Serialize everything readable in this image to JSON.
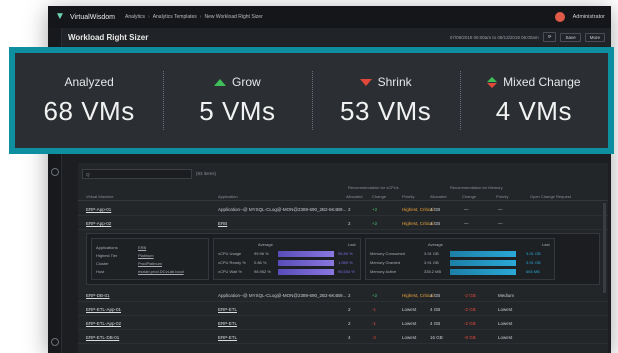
{
  "app": {
    "brand": "VirtualWisdom",
    "breadcrumbs": [
      "Analytics",
      "Analytics Templates",
      "New Workload Right Sizer"
    ],
    "user": "Administrator",
    "page_title": "Workload Right Sizer",
    "date_range": "07/09/2019 06:00am to 08/13/2019 06:00am",
    "save_label": "Save",
    "more_label": "More"
  },
  "summary": [
    {
      "id": "analyzed",
      "label": "Analyzed",
      "value": "68 VMs",
      "indicator": "none"
    },
    {
      "id": "grow",
      "label": "Grow",
      "value": "5 VMs",
      "indicator": "up",
      "color": "#3fbf5a"
    },
    {
      "id": "shrink",
      "label": "Shrink",
      "value": "53 VMs",
      "indicator": "down",
      "color": "#e0483a"
    },
    {
      "id": "mixed",
      "label": "Mixed Change",
      "value": "4 VMs",
      "indicator": "mixed"
    }
  ],
  "table": {
    "search_placeholder": "Q",
    "items_count": "(83 items)",
    "group_cpu": "Recommendation for vCPUs",
    "group_mem": "Recommendation for Memory",
    "columns": [
      "Virtual Machine",
      "Application",
      "Allocated",
      "Change",
      "Priority",
      "Allocated",
      "Change",
      "Priority",
      "Open Change Request"
    ],
    "rows": [
      {
        "vm": "ERP-App-01",
        "app": "Application--@ MYSQL-CLog@-MON@2389-690_2B2-6K4B9...",
        "cpu_alloc": "2",
        "cpu_change": "+2",
        "cpu_priority": "Highest, Critical",
        "mem_alloc": "4 GB",
        "mem_change": "—",
        "mem_priority": "—"
      },
      {
        "vm": "ERP-App-02",
        "app": "ERB",
        "cpu_alloc": "2",
        "cpu_change": "+2",
        "cpu_priority": "Highest, Critical",
        "mem_alloc": "4 GB",
        "mem_change": "—",
        "mem_priority": "—"
      },
      {
        "vm": "ERP-DB-01",
        "app": "Application--@ MYSQL-CLog@-MON@2389-690_2B2-6K4B9...",
        "cpu_alloc": "2",
        "cpu_change": "+2",
        "cpu_priority": "Highest, Critical",
        "mem_alloc": "4 GB",
        "mem_change": "-2 GB",
        "mem_priority": "Medium"
      },
      {
        "vm": "ERP-ETL-App-01",
        "app": "ERP-ETL",
        "cpu_alloc": "2",
        "cpu_change": "-1",
        "cpu_priority": "Lowest",
        "mem_alloc": "4 GB",
        "mem_change": "-2 GB",
        "mem_priority": "Lowest"
      },
      {
        "vm": "ERP-ETL-App-02",
        "app": "ERP-ETL",
        "cpu_alloc": "2",
        "cpu_change": "-1",
        "cpu_priority": "Lowest",
        "mem_alloc": "4 GB",
        "mem_change": "-2 GB",
        "mem_priority": "Lowest"
      },
      {
        "vm": "ERP-ETL-DB-01",
        "app": "ERP-ETL",
        "cpu_alloc": "4",
        "cpu_change": "-2",
        "cpu_priority": "Lowest",
        "mem_alloc": "16 GB",
        "mem_change": "-8 GB",
        "mem_priority": "Lowest"
      }
    ],
    "detail": {
      "applications_label": "Applications",
      "applications_value": "ERB",
      "highest_tier_label": "Highest Tier",
      "highest_tier_value": "Platinum",
      "cluster_label": "Cluster",
      "cluster_value": "ProdPlatinum",
      "host_label": "Host",
      "host_value": "esxlab.prod.DCvLab.local",
      "average_label": "Average",
      "last_label": "Last",
      "cpu_metrics": [
        {
          "name": "vCPU Usage",
          "avg": "99.96 %",
          "last": "98.89 %"
        },
        {
          "name": "vCPU Ready %",
          "avg": "0.86 %",
          "last": "1.069 %"
        },
        {
          "name": "vCPU Wait %",
          "avg": "98.952 %",
          "last": "95.534 %"
        }
      ],
      "mem_metrics": [
        {
          "name": "Memory Consumed",
          "avg": "3.91 GB",
          "last": "3.91 GB"
        },
        {
          "name": "Memory Granted",
          "avg": "3.91 GB",
          "last": "3.91 GB"
        },
        {
          "name": "Memory Active",
          "avg": "335.2 MB",
          "last": "665 MB"
        }
      ]
    }
  }
}
